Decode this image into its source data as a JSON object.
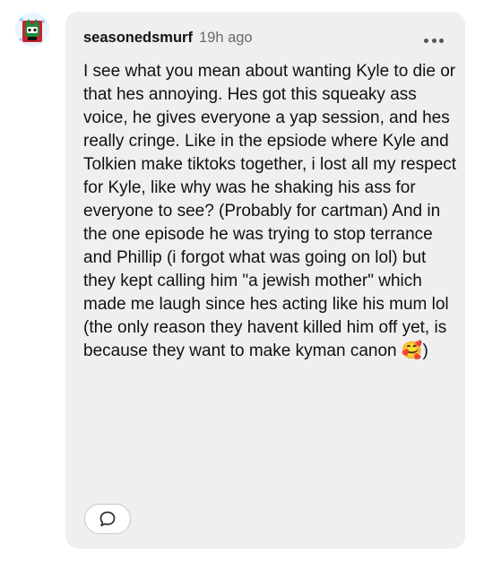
{
  "comment": {
    "avatar_icon": "cat-avatar-icon",
    "username": "seasonedsmurf",
    "timestamp": "19h ago",
    "more_icon": "ellipsis-icon",
    "text": "I see what you mean about wanting Kyle to die or that hes annoying. Hes got this squeaky ass voice, he gives everyone a yap session, and hes really cringe. Like in the epsiode where Kyle and Tolkien make tiktoks together, i lost all my respect for Kyle, like why was he shaking his ass for everyone to see? (Probably for cartman) And in the one episode he was trying to stop terrance and Phillip (i forgot what was going on lol) but they kept calling him \"a jewish mother\" which made me laugh since hes acting like his mum lol (the only reason they havent killed him off yet, is because they want to make kyman canon ",
    "emoji": "🥰",
    "text_end": ")",
    "reply_icon": "speech-bubble-icon"
  },
  "colors": {
    "bubble_background": "#efefef",
    "username": "#111111",
    "timestamp": "#6b6b6b",
    "avatar_background": "#e9f4ff",
    "avatar_red": "#c8232c",
    "avatar_green": "#1e8a3e"
  }
}
